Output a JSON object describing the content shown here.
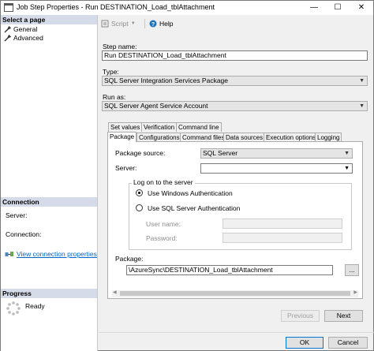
{
  "window": {
    "title": "Job Step Properties - Run DESTINATION_Load_tblAttachment",
    "minimize": "—",
    "maximize": "☐",
    "close": "✕"
  },
  "left_panel": {
    "select_page_header": "Select a page",
    "pages": [
      {
        "label": "General"
      },
      {
        "label": "Advanced"
      }
    ],
    "connection_header": "Connection",
    "server_label": "Server:",
    "connection_label": "Connection:",
    "view_connection_link": "View connection properties",
    "progress_header": "Progress",
    "progress_status": "Ready"
  },
  "toolbar": {
    "script_label": "Script",
    "help_label": "Help"
  },
  "form": {
    "step_name_label": "Step name:",
    "step_name_value": "Run DESTINATION_Load_tblAttachment",
    "type_label": "Type:",
    "type_value": "SQL Server Integration Services Package",
    "run_as_label": "Run as:",
    "run_as_value": "SQL Server Agent Service Account"
  },
  "tabs_row1": [
    {
      "label": "Set values"
    },
    {
      "label": "Verification"
    },
    {
      "label": "Command line"
    }
  ],
  "tabs_row2": [
    {
      "label": "Package",
      "active": true
    },
    {
      "label": "Configurations"
    },
    {
      "label": "Command files"
    },
    {
      "label": "Data sources"
    },
    {
      "label": "Execution options"
    },
    {
      "label": "Logging"
    }
  ],
  "package_tab": {
    "package_source_label": "Package source:",
    "package_source_value": "SQL Server",
    "server_label": "Server:",
    "server_value": "",
    "logon_group_label": "Log on to the server",
    "windows_auth_label": "Use Windows Authentication",
    "sql_auth_label": "Use SQL Server Authentication",
    "username_label": "User name:",
    "password_label": "Password:",
    "package_label": "Package:",
    "package_value": "\\AzureSync\\DESTINATION_Load_tblAttachment",
    "browse_label": "..."
  },
  "buttons": {
    "previous": "Previous",
    "next": "Next",
    "ok": "OK",
    "cancel": "Cancel"
  },
  "colors": {
    "section_header": "#d6dbe9",
    "link": "#0066cc",
    "accent_border": "#0078d7"
  }
}
